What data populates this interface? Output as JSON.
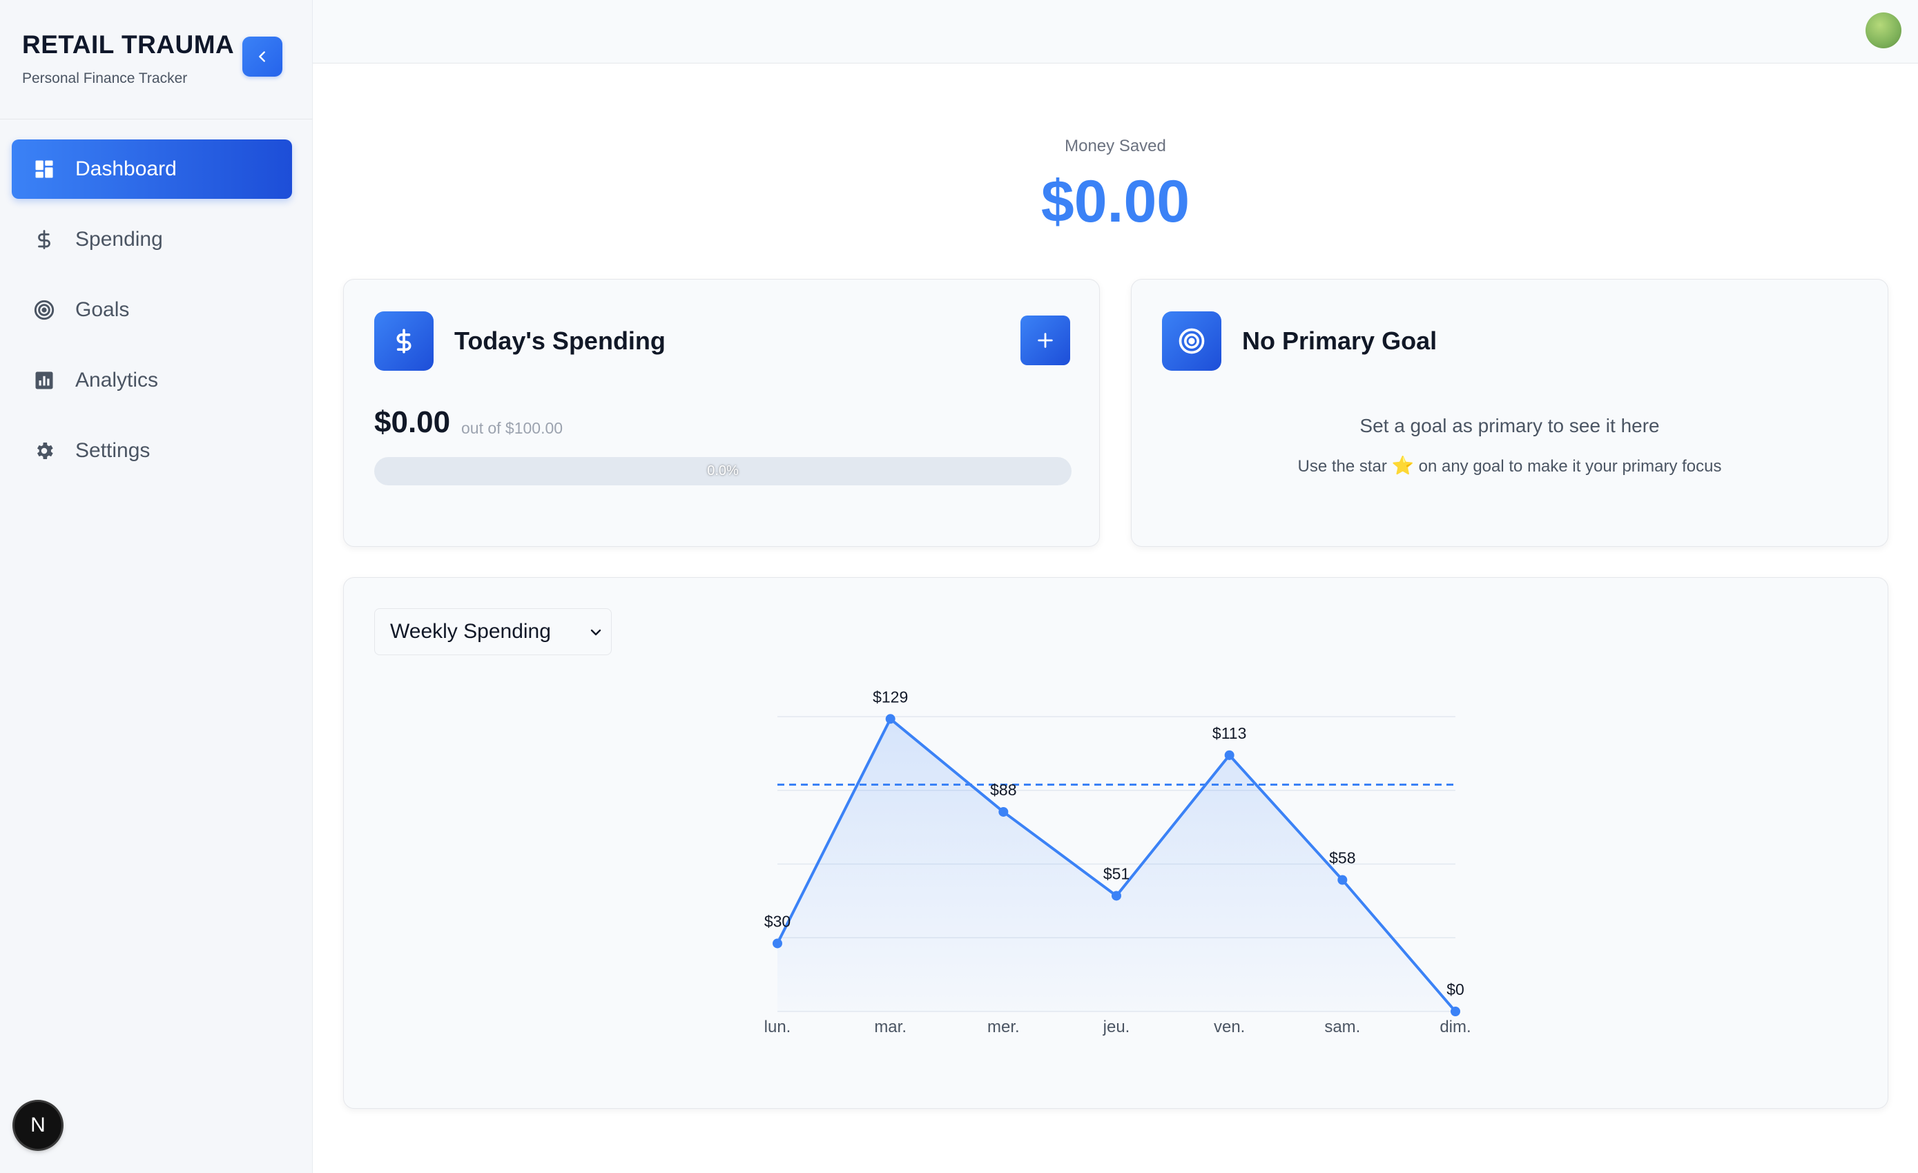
{
  "brand": {
    "title": "RETAIL TRAUMA",
    "subtitle": "Personal Finance Tracker"
  },
  "sidebar": {
    "items": [
      {
        "label": "Dashboard",
        "icon": "dashboard-icon",
        "active": true
      },
      {
        "label": "Spending",
        "icon": "dollar-icon",
        "active": false
      },
      {
        "label": "Goals",
        "icon": "target-icon",
        "active": false
      },
      {
        "label": "Analytics",
        "icon": "bar-chart-icon",
        "active": false
      },
      {
        "label": "Settings",
        "icon": "gear-icon",
        "active": false
      }
    ],
    "footer_badge": "N"
  },
  "money_saved": {
    "label": "Money Saved",
    "value": "$0.00"
  },
  "today": {
    "title": "Today's Spending",
    "amount": "$0.00",
    "limit_text": "out of $100.00",
    "progress_percent": 0,
    "progress_label": "0.0%"
  },
  "goal": {
    "title": "No Primary Goal",
    "message": "Set a goal as primary to see it here",
    "hint_before": "Use the star",
    "hint_star": "⭐",
    "hint_after": "on any goal to make it your primary focus"
  },
  "chart_select": {
    "value": "Weekly Spending"
  },
  "colors": {
    "accent": "#3b82f6",
    "accent_dark": "#1d4ed8"
  },
  "chart_data": {
    "type": "area",
    "categories": [
      "lun.",
      "mar.",
      "mer.",
      "jeu.",
      "ven.",
      "sam.",
      "dim."
    ],
    "values": [
      30,
      129,
      88,
      51,
      113,
      58,
      0
    ],
    "value_labels": [
      "$30",
      "$129",
      "$88",
      "$51",
      "$113",
      "$58",
      "$0"
    ],
    "reference_line": 100,
    "ylim": [
      0,
      130
    ],
    "grid": true
  }
}
